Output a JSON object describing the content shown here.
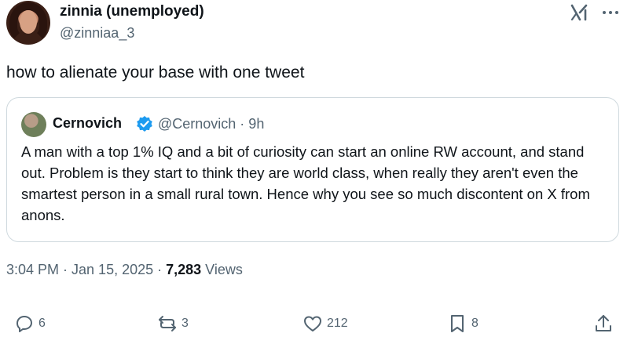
{
  "author": {
    "display_name": "zinnia (unemployed)",
    "handle": "@zinniaa_3"
  },
  "tweet": {
    "text": "how to alienate your base with one tweet"
  },
  "quoted_tweet": {
    "display_name": "Cernovich",
    "handle_time": "@Cernovich · 9h",
    "body": "A man with a top 1% IQ and a bit of curiosity can start an online RW account, and stand out. Problem is they start to think they are world class, when really they aren't even the smartest person in a small rural town. Hence why you see so much discontent on X from anons."
  },
  "meta": {
    "timestamp": "3:04 PM · Jan 15, 2025 · ",
    "views_count": "7,283",
    "views_label": " Views"
  },
  "actions": {
    "reply": {
      "icon": "reply-icon",
      "count": "6"
    },
    "repost": {
      "icon": "repost-icon",
      "count": "3"
    },
    "like": {
      "icon": "heart-icon",
      "count": "212"
    },
    "bookmark": {
      "icon": "bookmark-icon",
      "count": "8"
    },
    "share": {
      "icon": "share-icon"
    }
  },
  "colors": {
    "text_primary": "#0f1419",
    "text_secondary": "#536471",
    "border": "#cfd9de",
    "verified_blue": "#1d9bf0"
  }
}
